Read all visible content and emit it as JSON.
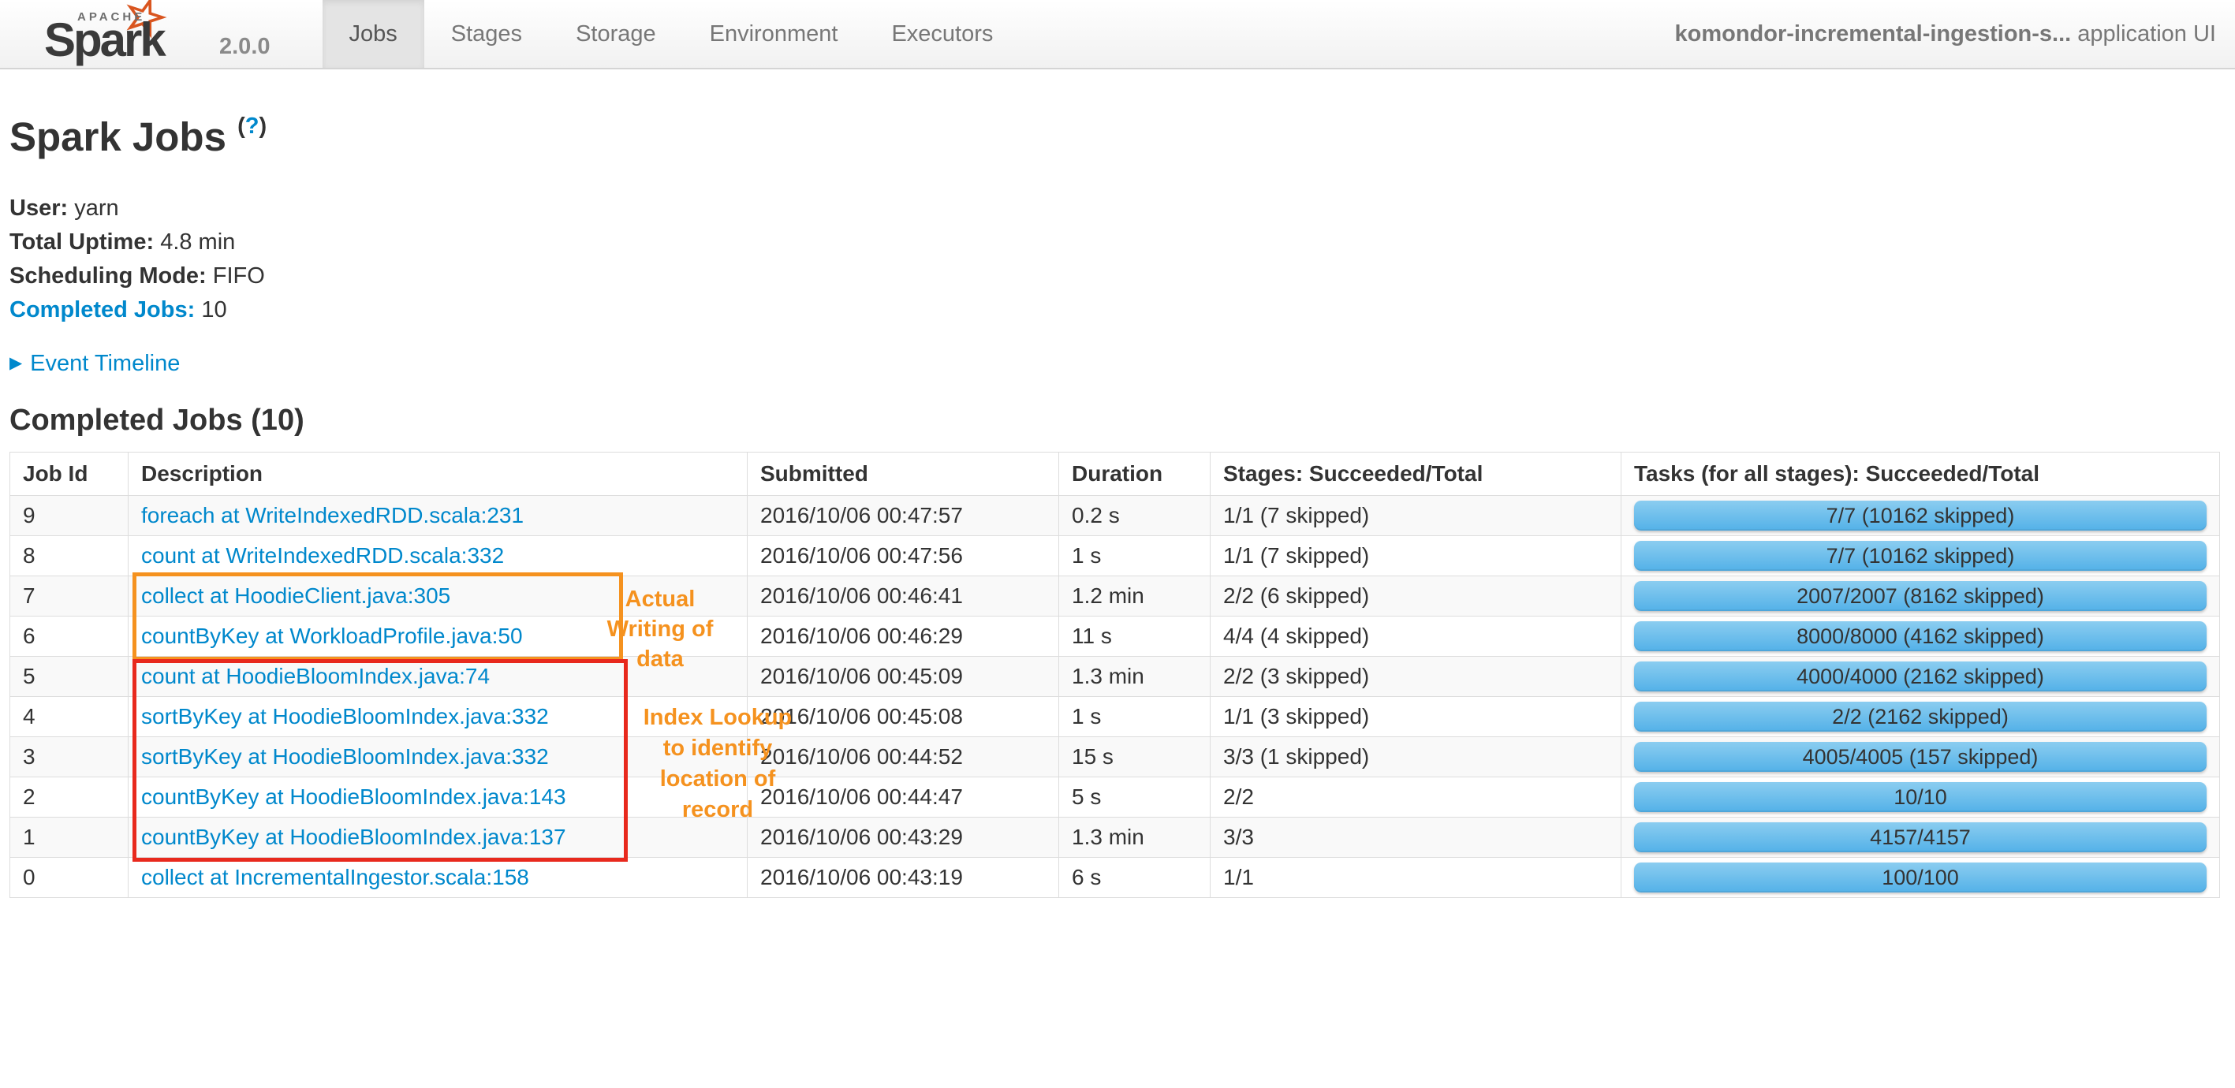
{
  "navbar": {
    "brand": {
      "apache": "APACHE",
      "name": "Spark",
      "version": "2.0.0"
    },
    "tabs": [
      {
        "label": "Jobs",
        "active": true
      },
      {
        "label": "Stages",
        "active": false
      },
      {
        "label": "Storage",
        "active": false
      },
      {
        "label": "Environment",
        "active": false
      },
      {
        "label": "Executors",
        "active": false
      }
    ],
    "app_name": "komondor-incremental-ingestion-s...",
    "app_suffix": " application UI"
  },
  "page": {
    "title": "Spark Jobs",
    "help_open": "(",
    "help_q": "?",
    "help_close": ")",
    "info": [
      {
        "label": "User:",
        "value": "yarn"
      },
      {
        "label": "Total Uptime:",
        "value": "4.8 min"
      },
      {
        "label": "Scheduling Mode:",
        "value": "FIFO"
      },
      {
        "label": "Completed Jobs:",
        "value": "10"
      }
    ],
    "event_timeline": {
      "arrow": "▶",
      "label": "Event Timeline"
    },
    "section_title": "Completed Jobs (10)"
  },
  "table": {
    "columns": [
      "Job Id",
      "Description",
      "Submitted",
      "Duration",
      "Stages: Succeeded/Total",
      "Tasks (for all stages): Succeeded/Total"
    ],
    "rows": [
      {
        "job_id": "9",
        "description": "foreach at WriteIndexedRDD.scala:231",
        "submitted": "2016/10/06 00:47:57",
        "duration": "0.2 s",
        "stages": "1/1 (7 skipped)",
        "tasks": "7/7 (10162 skipped)"
      },
      {
        "job_id": "8",
        "description": "count at WriteIndexedRDD.scala:332",
        "submitted": "2016/10/06 00:47:56",
        "duration": "1 s",
        "stages": "1/1 (7 skipped)",
        "tasks": "7/7 (10162 skipped)"
      },
      {
        "job_id": "7",
        "description": "collect at HoodieClient.java:305",
        "submitted": "2016/10/06 00:46:41",
        "duration": "1.2 min",
        "stages": "2/2 (6 skipped)",
        "tasks": "2007/2007 (8162 skipped)"
      },
      {
        "job_id": "6",
        "description": "countByKey at WorkloadProfile.java:50",
        "submitted": "2016/10/06 00:46:29",
        "duration": "11 s",
        "stages": "4/4 (4 skipped)",
        "tasks": "8000/8000 (4162 skipped)"
      },
      {
        "job_id": "5",
        "description": "count at HoodieBloomIndex.java:74",
        "submitted": "2016/10/06 00:45:09",
        "duration": "1.3 min",
        "stages": "2/2 (3 skipped)",
        "tasks": "4000/4000 (2162 skipped)"
      },
      {
        "job_id": "4",
        "description": "sortByKey at HoodieBloomIndex.java:332",
        "submitted": "2016/10/06 00:45:08",
        "duration": "1 s",
        "stages": "1/1 (3 skipped)",
        "tasks": "2/2 (2162 skipped)"
      },
      {
        "job_id": "3",
        "description": "sortByKey at HoodieBloomIndex.java:332",
        "submitted": "2016/10/06 00:44:52",
        "duration": "15 s",
        "stages": "3/3 (1 skipped)",
        "tasks": "4005/4005 (157 skipped)"
      },
      {
        "job_id": "2",
        "description": "countByKey at HoodieBloomIndex.java:143",
        "submitted": "2016/10/06 00:44:47",
        "duration": "5 s",
        "stages": "2/2",
        "tasks": "10/10"
      },
      {
        "job_id": "1",
        "description": "countByKey at HoodieBloomIndex.java:137",
        "submitted": "2016/10/06 00:43:29",
        "duration": "1.3 min",
        "stages": "3/3",
        "tasks": "4157/4157"
      },
      {
        "job_id": "0",
        "description": "collect at IncrementalIngestor.scala:158",
        "submitted": "2016/10/06 00:43:19",
        "duration": "6 s",
        "stages": "1/1",
        "tasks": "100/100"
      }
    ]
  },
  "annotations": {
    "writing": {
      "lines": [
        "Actual",
        "Writing of",
        "data"
      ],
      "box_color": "#f5921f",
      "text_color": "#f5921f"
    },
    "lookup": {
      "lines": [
        "Index Lookup",
        "to identify",
        "location of",
        "record"
      ],
      "box_color": "#e8291d",
      "text_color": "#f5921f"
    }
  },
  "colors": {
    "link_blue": "#0088cc",
    "progress_bar_top": "#8bcdf0",
    "progress_bar_bottom": "#53b1e8",
    "row_stripe": "#f9f9f9",
    "table_border": "#dddddd",
    "annotation_orange": "#f5921f",
    "annotation_red": "#e8291d"
  }
}
